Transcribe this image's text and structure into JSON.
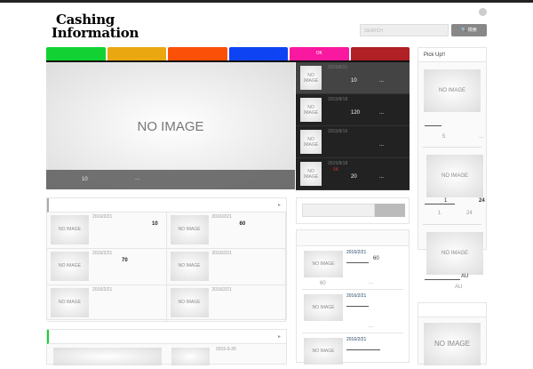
{
  "header": {
    "logo_line1": "Cashing",
    "logo_line2": "Information",
    "search_placeholder": "SEARCH",
    "search_button": "🔍 検索"
  },
  "nav": {
    "items": [
      {
        "label": "",
        "color": "#11d232"
      },
      {
        "label": "",
        "color": "#eaa710"
      },
      {
        "label": "",
        "color": "#fb5007"
      },
      {
        "label": "",
        "color": "#0e43f3"
      },
      {
        "label": "OK",
        "color": "#f918a0"
      },
      {
        "label": "",
        "color": "#b02025"
      }
    ]
  },
  "hero": {
    "image": "NO IMAGE",
    "caption_num": "10",
    "caption_more": "..."
  },
  "featured": [
    {
      "thumb": "NO IMAGE",
      "date": "2015/8/31",
      "num": "10",
      "more": "..."
    },
    {
      "thumb": "NO IMAGE",
      "date": "2015/8/18",
      "num": "120",
      "more": "..."
    },
    {
      "thumb": "NO IMAGE",
      "date": "2015/8/16",
      "num": "",
      "more": "..."
    },
    {
      "thumb": "NO IMAGE",
      "date": "2015/8/18",
      "tag": "5K",
      "num": "20",
      "more": "..."
    }
  ],
  "section1": {
    "arrow": "▸",
    "items": [
      {
        "thumb": "NO IMAGE",
        "date": "2016/2/21",
        "num": "10"
      },
      {
        "thumb": "NO IMAGE",
        "date": "2016/2/21",
        "num": "60"
      },
      {
        "thumb": "NO IMAGE",
        "date": "2016/2/21",
        "num": "70"
      },
      {
        "thumb": "NO IMAGE",
        "date": "2016/2/21",
        "num": ""
      },
      {
        "thumb": "NO IMAGE",
        "date": "2016/2/21",
        "num": ""
      },
      {
        "thumb": "NO IMAGE",
        "date": "2016/2/21",
        "num": ""
      }
    ]
  },
  "section2": {
    "arrow": "▸",
    "date": "2015-9-26"
  },
  "middle": {
    "items": [
      {
        "thumb": "NO IMAGE",
        "date": "2016/2/21",
        "num": "60",
        "sub": "60",
        "more": "..."
      },
      {
        "thumb": "NO IMAGE",
        "date": "2016/2/21",
        "num": "",
        "sub": "",
        "more": "..."
      },
      {
        "thumb": "NO IMAGE",
        "date": "2016/2/21",
        "num": "",
        "sub": "",
        "more": ""
      }
    ]
  },
  "sidebar": {
    "title": "Pick Up!!",
    "items": [
      {
        "thumb": "NO IMAGE",
        "title": "",
        "sub1": "5",
        "sub2": "..."
      },
      {
        "thumb": "NO IMAGE",
        "title": "1",
        "title2": "24",
        "sub1": "1",
        "sub2": "24"
      },
      {
        "thumb": "NO IMAGE",
        "title": "AU",
        "sub1": "AU",
        "sub2": ""
      }
    ],
    "thumb2": "NO IMAGE"
  }
}
